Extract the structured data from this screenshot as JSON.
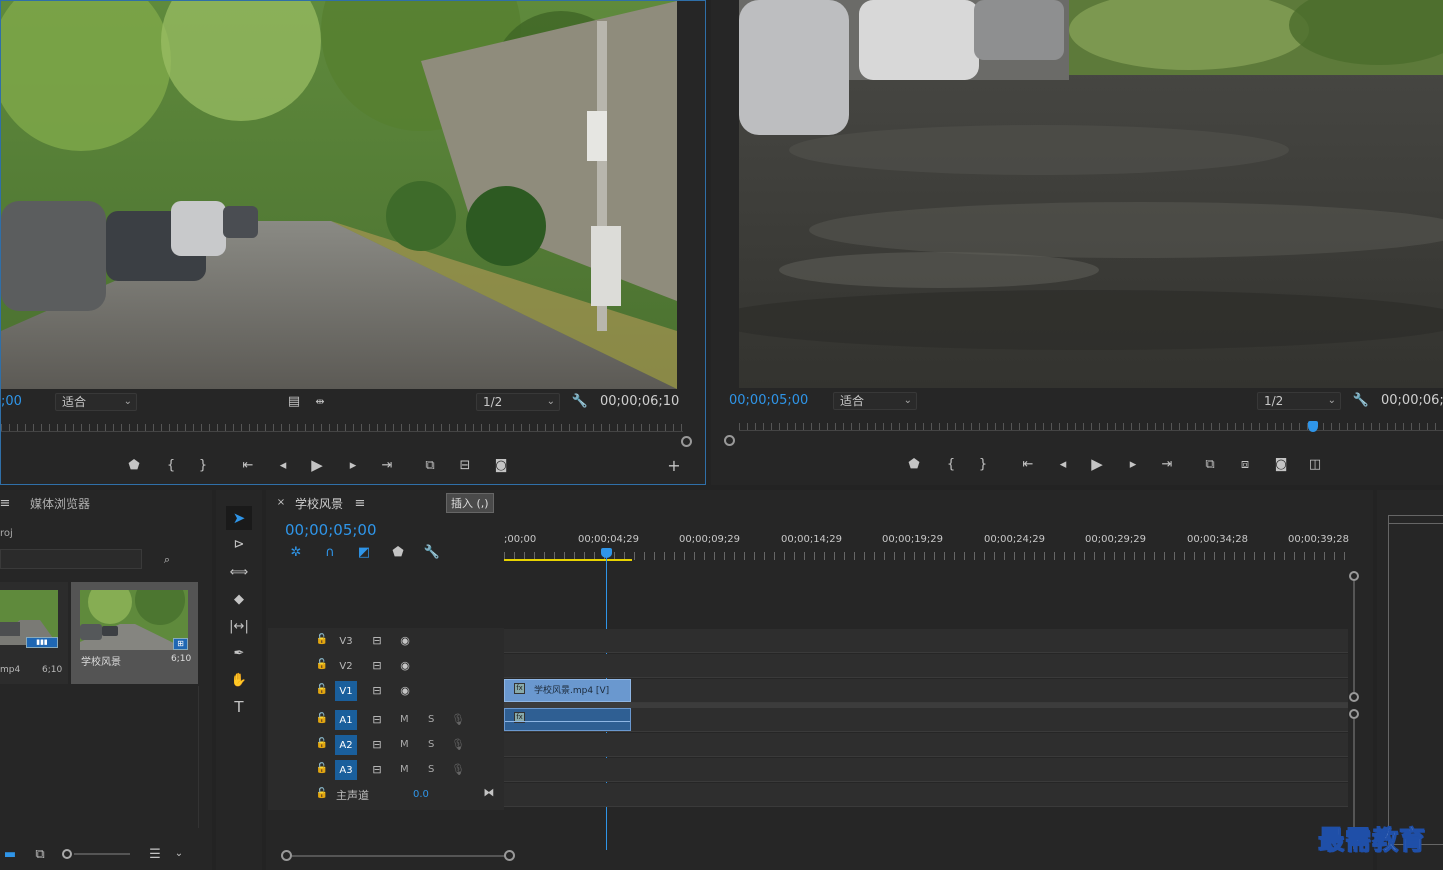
{
  "source_monitor": {
    "timecode_left": ";00",
    "fit_label": "适合",
    "resolution": "1/2",
    "duration": "00;00;06;10"
  },
  "program_monitor": {
    "timecode": "00;00;05;00",
    "fit_label": "适合",
    "resolution": "1/2",
    "duration": "00;00;06;"
  },
  "project_panel": {
    "tab_label": "媒体浏览器",
    "project_name": "roj",
    "items": [
      {
        "name": "mp4",
        "duration": "6;10"
      },
      {
        "name": "学校风景",
        "duration": "6;10"
      }
    ]
  },
  "timeline": {
    "sequence_name": "学校风景",
    "insert_label": "插入 (,)",
    "timecode": "00;00;05;00",
    "ruler_labels": [
      ";00;00",
      "00;00;04;29",
      "00;00;09;29",
      "00;00;14;29",
      "00;00;19;29",
      "00;00;24;29",
      "00;00;29;29",
      "00;00;34;28",
      "00;00;39;28"
    ],
    "video_tracks": [
      "V3",
      "V2",
      "V1"
    ],
    "audio_tracks": [
      "A1",
      "A2",
      "A3"
    ],
    "mute_label": "M",
    "solo_label": "S",
    "master_label": "主声道",
    "master_value": "0.0",
    "clip_label": "学校风景.mp4 [V]"
  },
  "watermark": "最需教育",
  "colors": {
    "accent_blue": "#2f95e8",
    "panel_bg": "#262626",
    "clip_blue": "#6a98cf",
    "work_area_yellow": "#e8d300"
  }
}
